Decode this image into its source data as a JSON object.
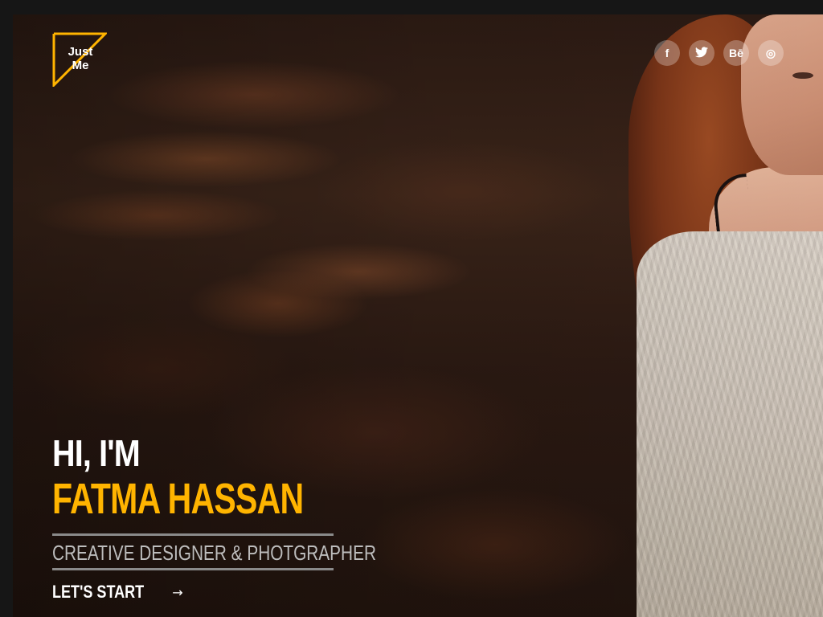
{
  "logo": {
    "line1": "Just",
    "line2": "Me",
    "accent_color": "#ffb400"
  },
  "social": [
    {
      "name": "facebook-icon",
      "glyph": "f"
    },
    {
      "name": "twitter-icon",
      "glyph": "🐦"
    },
    {
      "name": "behance-icon",
      "glyph": "Bē"
    },
    {
      "name": "dribbble-icon",
      "glyph": "◎"
    }
  ],
  "hero": {
    "greeting": "HI, I'M",
    "name": "FATMA HASSAN",
    "role": "CREATIVE DESIGNER & PHOTGRAPHER",
    "cta_label": "LET'S START",
    "cta_icon": "→",
    "name_color": "#ffb400"
  }
}
